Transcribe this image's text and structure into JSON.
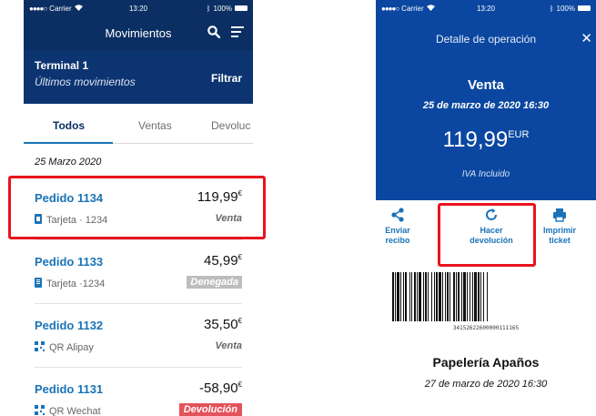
{
  "left": {
    "status": {
      "carrier": "Carrier",
      "time": "13:20",
      "battery": "100%"
    },
    "header": {
      "title": "Movimientos"
    },
    "subheader": {
      "terminal": "Terminal 1",
      "subtitle": "Últimos movimientos",
      "filter": "Filtrar"
    },
    "tabs": [
      {
        "label": "Todos"
      },
      {
        "label": "Ventas"
      },
      {
        "label": "Devoluc"
      }
    ],
    "date_group": "25 Marzo 2020",
    "rows": [
      {
        "order": "Pedido 1134",
        "amount": "119,99",
        "currency": "€",
        "method": "Tarjeta · 1234",
        "status": "Venta",
        "icon": "card-icon"
      },
      {
        "order": "Pedido 1133",
        "amount": "45,99",
        "currency": "€",
        "method": "Tarjeta ·1234",
        "status": "Denegada",
        "icon": "card-icon"
      },
      {
        "order": "Pedido 1132",
        "amount": "35,50",
        "currency": "€",
        "method": "QR Alipay",
        "status": "Venta",
        "icon": "qr-icon"
      },
      {
        "order": "Pedido 1131",
        "amount": "-58,90",
        "currency": "€",
        "method": "QR Wechat",
        "status": "Devolución",
        "icon": "qr-icon"
      }
    ]
  },
  "right": {
    "status": {
      "carrier": "Carrier",
      "time": "13:20",
      "battery": "100%"
    },
    "header": {
      "title": "Detalle de operación"
    },
    "operation": {
      "type": "Venta",
      "date": "25 de marzo de 2020 16:30",
      "amount": "119,99",
      "currency": "EUR",
      "tax_note": "IVA Incluido"
    },
    "actions": {
      "send_line1": "Enviar",
      "send_line2": "recibo",
      "return_line1": "Hacer",
      "return_line2": "devolución",
      "print_line1": "Imprimir",
      "print_line2": "ticket"
    },
    "barcode_number": "34152622600000111165",
    "shop": {
      "name": "Papelería Apaños",
      "date": "27 de marzo de 2020 16:30"
    }
  },
  "colors": {
    "navy": "#0b2f63",
    "blue": "#0b47a0",
    "link": "#1973b8",
    "highlight": "#e8141c",
    "return_badge": "#e3535b",
    "denied_badge": "#bdbdbd"
  }
}
